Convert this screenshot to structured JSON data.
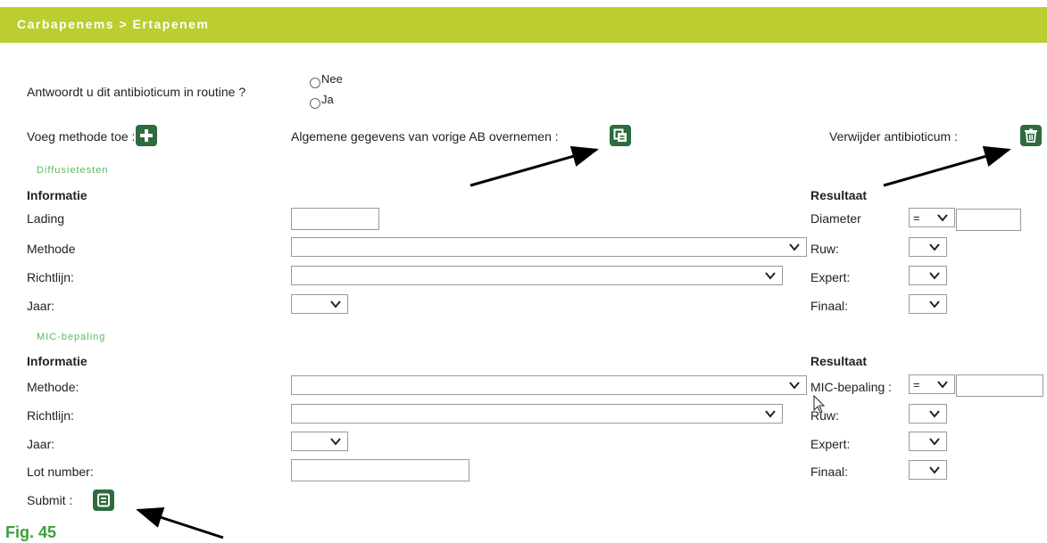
{
  "colors": {
    "accent": "#bccd2f",
    "button": "#2e6b3e",
    "small_heading": "#5cb85c",
    "figure_label": "#3aa13a"
  },
  "header": {
    "title": "Carbapenems > Ertapenem"
  },
  "routine": {
    "question": "Antwoordt u dit antibioticum in routine ?",
    "options": [
      "Nee",
      "Ja"
    ]
  },
  "actions": {
    "add_method_label": "Voeg methode toe :",
    "copy_label": "Algemene gegevens van vorige AB overnemen :",
    "delete_label": "Verwijder antibioticum :"
  },
  "diffusion": {
    "section_title": "Diffusietesten",
    "info_heading": "Informatie",
    "result_heading": "Resultaat",
    "lading_label": "Lading",
    "methode_label": "Methode",
    "richtlijn_label": "Richtlijn:",
    "jaar_label": "Jaar:",
    "diameter_label": "Diameter",
    "diameter_operator": "=",
    "ruw_label": "Ruw:",
    "expert_label": "Expert:",
    "finaal_label": "Finaal:"
  },
  "mic": {
    "section_title": "MIC-bepaling",
    "info_heading": "Informatie",
    "result_heading": "Resultaat",
    "methode_label": "Methode:",
    "richtlijn_label": "Richtlijn:",
    "jaar_label": "Jaar:",
    "lot_label": "Lot number:",
    "mic_label": "MIC-bepaling :",
    "mic_operator": "=",
    "ruw_label": "Ruw:",
    "expert_label": "Expert:",
    "finaal_label": "Finaal:"
  },
  "submit": {
    "label": "Submit :"
  },
  "figure": {
    "label": "Fig. 45"
  },
  "icons": {
    "add": "plus-icon",
    "copy": "copy-icon",
    "delete": "trash-icon",
    "submit": "form-icon"
  }
}
